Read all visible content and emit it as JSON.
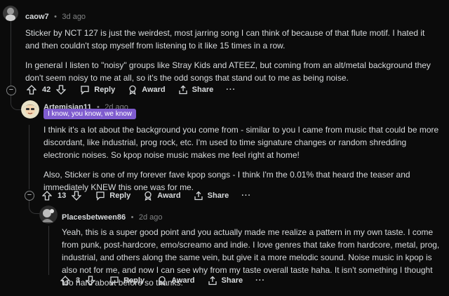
{
  "comments": [
    {
      "user": "caow7",
      "time": "3d ago",
      "paragraphs": [
        "Sticker by NCT 127 is just the weirdest, most jarring song I can think of because of that flute motif. I hated it and then couldn't stop myself from listening to it like 15 times in a row.",
        "In general I listen to \"noisy\" groups like Stray Kids and ATEEZ, but coming from an alt/metal background they don't seem noisy to me at all, so it's the odd songs that stand out to me as being noise."
      ],
      "votes": "42",
      "reply_label": "Reply",
      "award_label": "Award",
      "share_label": "Share",
      "more_label": "···",
      "collapse_label": "−"
    },
    {
      "user": "Artemisian11",
      "time": "2d ago",
      "flair": "I know, you know, we know",
      "paragraphs": [
        "I think it's a lot about the background you come from - similar to you I came from music that could be more discordant, like industrial, prog rock, etc. I'm used to time signature changes or random shredding electronic noises. So kpop noise music makes me feel right at home!",
        "Also, Sticker is one of my forever fave kpop songs - I think I'm the 0.01% that heard the teaser and immediately KNEW this one was for me."
      ],
      "votes": "13",
      "reply_label": "Reply",
      "award_label": "Award",
      "share_label": "Share",
      "more_label": "···",
      "collapse_label": "−"
    },
    {
      "user": "Placesbetween86",
      "time": "2d ago",
      "paragraphs": [
        "Yeah, this is a super good point and you actually made me realize a pattern in my own taste. I come from punk, post-hardcore, emo/screamo and indie. I love genres that take from hardcore, metal, prog, industrial, and others along the same vein, but give it a more melodic sound. Noise music in kpop is also not for me, and now I can see why from my taste overall taste haha. It isn't something I thought too hard about before so thanks."
      ],
      "votes": "3",
      "reply_label": "Reply",
      "award_label": "Award",
      "share_label": "Share",
      "more_label": "···"
    }
  ],
  "separator": "•",
  "colors": {
    "background": "#0b0b0b",
    "text": "#d7dadc",
    "meta": "#818384",
    "thread_line": "#343536",
    "flair_bg": "#7f5ccf"
  }
}
